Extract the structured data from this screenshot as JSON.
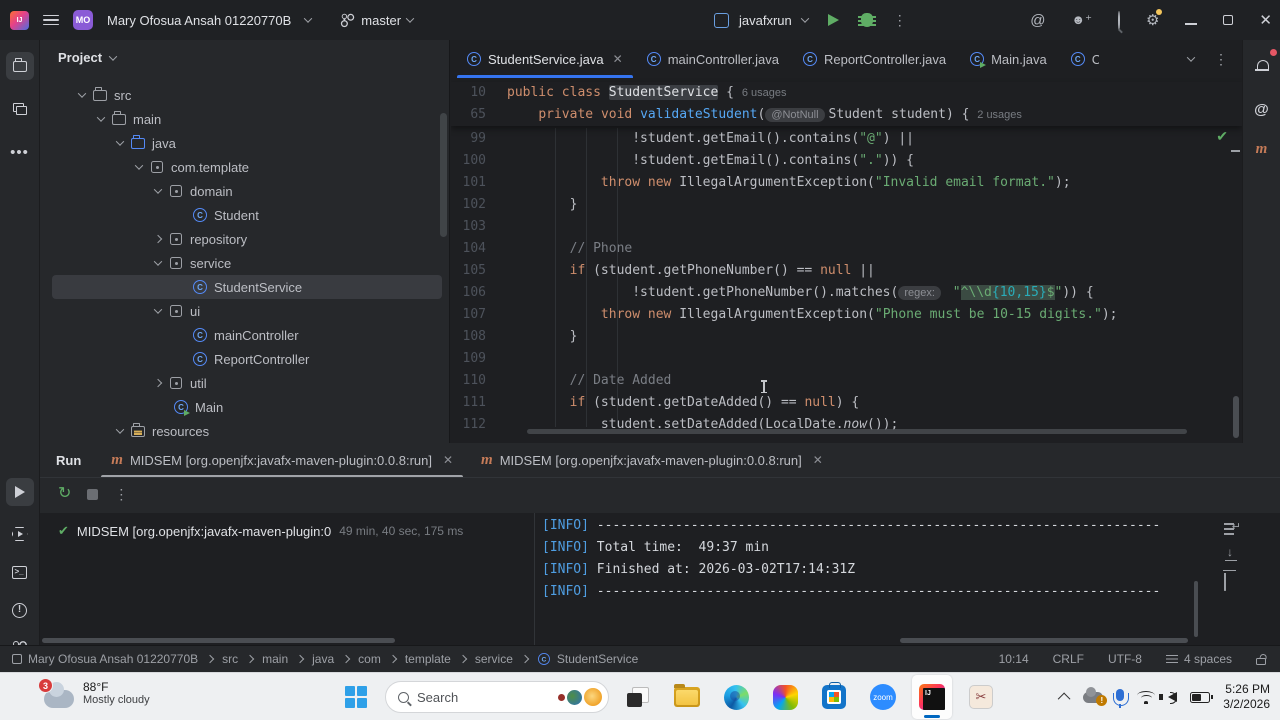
{
  "colors": {
    "accent": "#3574f0",
    "editor_bg": "#1e1f22",
    "panel_bg": "#26282b",
    "selection": "#393b40",
    "keyword": "#cf8e6d",
    "string": "#6aab73",
    "comment": "#7a7e85",
    "method": "#56a8f5",
    "info_tag": "#4f9ee3",
    "run_green": "#5fad65",
    "maven": "#c57b58",
    "taskbar_bg": "#eef0f2"
  },
  "titlebar": {
    "project_initials": "MO",
    "project_name": "Mary Ofosua Ansah 01220770B",
    "branch": "master",
    "run_config": "javafxrun",
    "right_icons": [
      "ai",
      "add-user",
      "search",
      "settings",
      "minimize",
      "restore",
      "close"
    ]
  },
  "left_stripe_top": [
    "project",
    "structure",
    "more"
  ],
  "left_stripe_bottom": [
    "run",
    "services",
    "terminal",
    "problems",
    "git"
  ],
  "right_stripe": [
    "bell",
    "ai",
    "maven"
  ],
  "project": {
    "header": "Project",
    "items": [
      {
        "label": "src",
        "icon": "folder",
        "chev": "down",
        "pad": 38
      },
      {
        "label": "main",
        "icon": "folder",
        "chev": "down",
        "pad": 57
      },
      {
        "label": "java",
        "icon": "folder-src",
        "chev": "down",
        "pad": 76
      },
      {
        "label": "com.template",
        "icon": "pkg",
        "chev": "down",
        "pad": 95
      },
      {
        "label": "domain",
        "icon": "pkg",
        "chev": "down",
        "pad": 114
      },
      {
        "label": "Student",
        "icon": "class",
        "pad": 152
      },
      {
        "label": "repository",
        "icon": "pkg",
        "chev": "right",
        "pad": 114
      },
      {
        "label": "service",
        "icon": "pkg",
        "chev": "down",
        "pad": 114
      },
      {
        "label": "StudentService",
        "icon": "class",
        "pad": 152,
        "selected": true
      },
      {
        "label": "ui",
        "icon": "pkg",
        "chev": "down",
        "pad": 114
      },
      {
        "label": "mainController",
        "icon": "class",
        "pad": 152
      },
      {
        "label": "ReportController",
        "icon": "class",
        "pad": 152
      },
      {
        "label": "util",
        "icon": "pkg",
        "chev": "right",
        "pad": 114
      },
      {
        "label": "Main",
        "icon": "class-run",
        "pad": 133
      },
      {
        "label": "resources",
        "icon": "folder-res",
        "chev": "down",
        "pad": 76
      }
    ]
  },
  "editor": {
    "tabs": [
      {
        "label": "StudentService.java",
        "icon": "class",
        "active": true,
        "close": true
      },
      {
        "label": "mainController.java",
        "icon": "class"
      },
      {
        "label": "ReportController.java",
        "icon": "class"
      },
      {
        "label": "Main.java",
        "icon": "class-run"
      },
      {
        "label": "C",
        "icon": "class",
        "partial": true
      }
    ],
    "sticky_lines": [
      {
        "num": "10",
        "tokens": [
          [
            "k",
            "public "
          ],
          [
            "k",
            "class "
          ],
          [
            "hl",
            "StudentService"
          ],
          [
            "d",
            " { "
          ],
          [
            "us",
            "6 usages"
          ]
        ]
      },
      {
        "num": "65",
        "tokens": [
          [
            "d",
            "    "
          ],
          [
            "k",
            "private "
          ],
          [
            "k",
            "void "
          ],
          [
            "m",
            "validateStudent"
          ],
          [
            "d",
            "("
          ],
          [
            "hint",
            "@NotNull"
          ],
          [
            "d",
            "Student student) { "
          ],
          [
            "us",
            "2 usages"
          ]
        ]
      }
    ],
    "lines": [
      {
        "num": "99",
        "tokens": [
          [
            "d",
            "                !student.getEmail().contains("
          ],
          [
            "s",
            "\"@\""
          ],
          [
            "d",
            ") ||"
          ]
        ]
      },
      {
        "num": "100",
        "tokens": [
          [
            "d",
            "                !student.getEmail().contains("
          ],
          [
            "s",
            "\".\""
          ],
          [
            "d",
            ")) {"
          ]
        ]
      },
      {
        "num": "101",
        "tokens": [
          [
            "d",
            "            "
          ],
          [
            "k",
            "throw "
          ],
          [
            "k",
            "new "
          ],
          [
            "d",
            "IllegalArgumentException("
          ],
          [
            "s",
            "\"Invalid email format.\""
          ],
          [
            "d",
            ");"
          ]
        ]
      },
      {
        "num": "102",
        "tokens": [
          [
            "d",
            "        }"
          ]
        ]
      },
      {
        "num": "103",
        "tokens": []
      },
      {
        "num": "104",
        "tokens": [
          [
            "c",
            "        // Phone"
          ]
        ]
      },
      {
        "num": "105",
        "tokens": [
          [
            "d",
            "        "
          ],
          [
            "k",
            "if "
          ],
          [
            "d",
            "(student.getPhoneNumber() == "
          ],
          [
            "k",
            "null"
          ],
          [
            "d",
            " ||"
          ]
        ]
      },
      {
        "num": "106",
        "tokens": [
          [
            "d",
            "                !student.getPhoneNumber().matches("
          ],
          [
            "hint",
            "regex:"
          ],
          [
            "d",
            " "
          ],
          [
            "s",
            "\""
          ],
          [
            "rx",
            "^\\\\d"
          ],
          [
            "rxn",
            "{10,15}"
          ],
          [
            "rx",
            "$"
          ],
          [
            "s",
            "\""
          ],
          [
            "d",
            ")) {"
          ]
        ]
      },
      {
        "num": "107",
        "tokens": [
          [
            "d",
            "            "
          ],
          [
            "k",
            "throw "
          ],
          [
            "k",
            "new "
          ],
          [
            "d",
            "IllegalArgumentException("
          ],
          [
            "s",
            "\"Phone must be 10-15 digits.\""
          ],
          [
            "d",
            ");"
          ]
        ]
      },
      {
        "num": "108",
        "tokens": [
          [
            "d",
            "        }"
          ]
        ]
      },
      {
        "num": "109",
        "tokens": []
      },
      {
        "num": "110",
        "tokens": [
          [
            "c",
            "        // Date Added"
          ]
        ]
      },
      {
        "num": "111",
        "tokens": [
          [
            "d",
            "        "
          ],
          [
            "k",
            "if "
          ],
          [
            "d",
            "(student.getDateAdded() == "
          ],
          [
            "k",
            "null"
          ],
          [
            "d",
            ") {"
          ]
        ]
      },
      {
        "num": "112",
        "tokens": [
          [
            "d",
            "            student.setDateAdded(LocalDate."
          ],
          [
            "it",
            "now"
          ],
          [
            "d",
            "());"
          ]
        ]
      }
    ]
  },
  "run": {
    "title": "Run",
    "tabs": [
      {
        "label": "MIDSEM [org.openjfx:javafx-maven-plugin:0.0.8:run]",
        "active": true
      },
      {
        "label": "MIDSEM [org.openjfx:javafx-maven-plugin:0.0.8:run]"
      }
    ],
    "node": {
      "label": "MIDSEM [org.openjfx:javafx-maven-plugin:0",
      "meta": "49 min, 40 sec, 175 ms"
    },
    "console": [
      {
        "tag": "[INFO]",
        "text": " ------------------------------------------------------------------------"
      },
      {
        "tag": "[INFO]",
        "text": " Total time:  49:37 min"
      },
      {
        "tag": "[INFO]",
        "text": " Finished at: 2026-03-02T17:14:31Z"
      },
      {
        "tag": "[INFO]",
        "text": " ------------------------------------------------------------------------"
      }
    ]
  },
  "statusbar": {
    "crumbs": [
      "Mary Ofosua Ansah 01220770B",
      "src",
      "main",
      "java",
      "com",
      "template",
      "service",
      "StudentService"
    ],
    "caret": "10:14",
    "line_ending": "CRLF",
    "encoding": "UTF-8",
    "indent": "4 spaces"
  },
  "taskbar": {
    "weather_badge": "3",
    "weather_temp": "88°F",
    "weather_cond": "Mostly cloudy",
    "search_label": "Search",
    "zoom_label": "zoom",
    "apps": [
      "start",
      "search-pill",
      "task-view",
      "explorer",
      "edge",
      "copilot",
      "store",
      "zoom",
      "intellij",
      "snipping"
    ],
    "time": "5:26 PM",
    "date": "3/2/2026"
  }
}
